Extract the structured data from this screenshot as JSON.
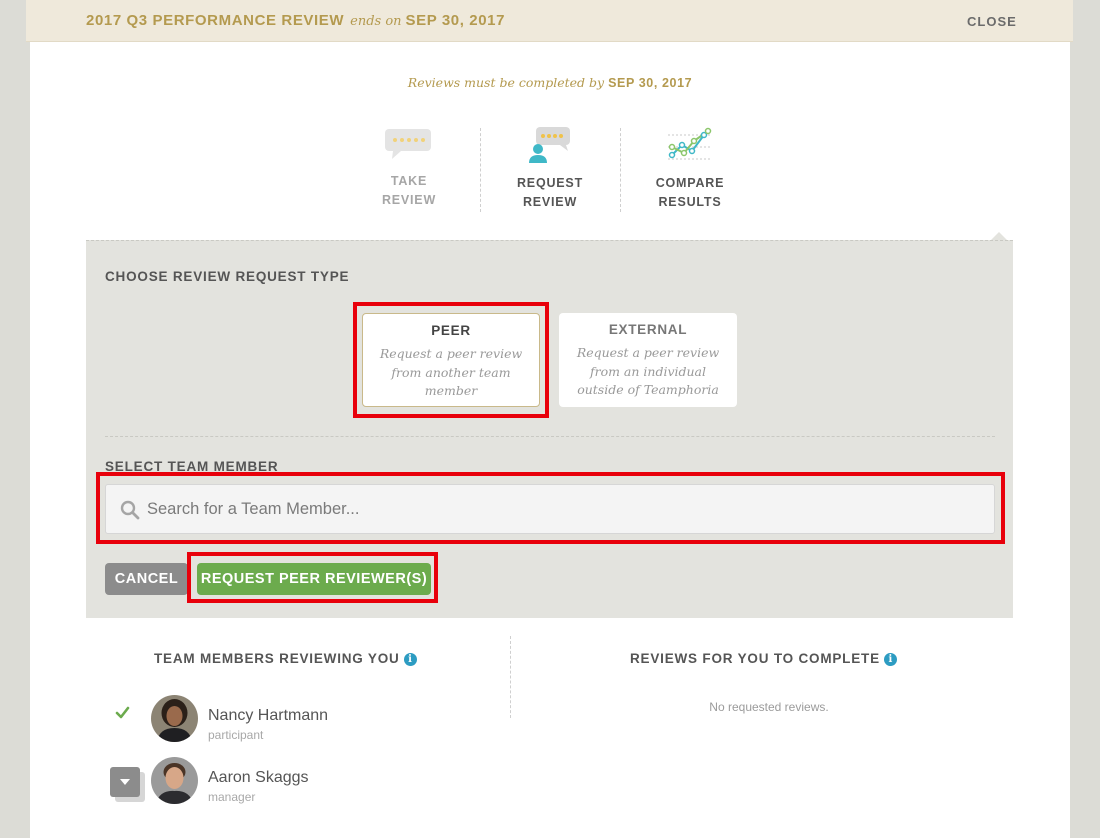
{
  "header": {
    "review_title": "2017 Q3 PERFORMANCE REVIEW",
    "ends_on_label": "ends on",
    "end_date": "SEP 30, 2017",
    "close_label": "CLOSE"
  },
  "deadline": {
    "text": "Reviews must be completed by",
    "date": "SEP 30, 2017"
  },
  "steps": [
    {
      "line1": "TAKE",
      "line2": "REVIEW",
      "icon": "speech-bubble-stars-icon"
    },
    {
      "line1": "REQUEST",
      "line2": "REVIEW",
      "icon": "person-stars-icon"
    },
    {
      "line1": "COMPARE",
      "line2": "RESULTS",
      "icon": "line-graph-icon"
    }
  ],
  "request_panel": {
    "choose_title": "CHOOSE REVIEW REQUEST TYPE",
    "types": [
      {
        "title": "PEER",
        "desc_lines": [
          "Request a peer review",
          "from another team",
          "member"
        ],
        "selected": true
      },
      {
        "title": "EXTERNAL",
        "desc_lines": [
          "Request a peer review",
          "from an individual",
          "outside of Teamphoria"
        ],
        "selected": false
      }
    ],
    "select_title": "SELECT TEAM MEMBER",
    "search_placeholder": "Search for a Team Member...",
    "cancel_label": "CANCEL",
    "submit_label": "REQUEST PEER REVIEWER(S)"
  },
  "reviewing_you": {
    "title": "TEAM MEMBERS REVIEWING YOU",
    "members": [
      {
        "name": "Nancy Hartmann",
        "role": "participant",
        "status": "check-icon"
      },
      {
        "name": "Aaron Skaggs",
        "role": "manager",
        "status": "dropdown-button"
      }
    ]
  },
  "to_complete": {
    "title": "REVIEWS FOR YOU TO COMPLETE",
    "empty_text": "No requested reviews."
  },
  "colors": {
    "gold": "#b49a4f",
    "green": "#6cab4d",
    "info_blue": "#2d9cc2",
    "highlight_red": "#e8000b"
  }
}
